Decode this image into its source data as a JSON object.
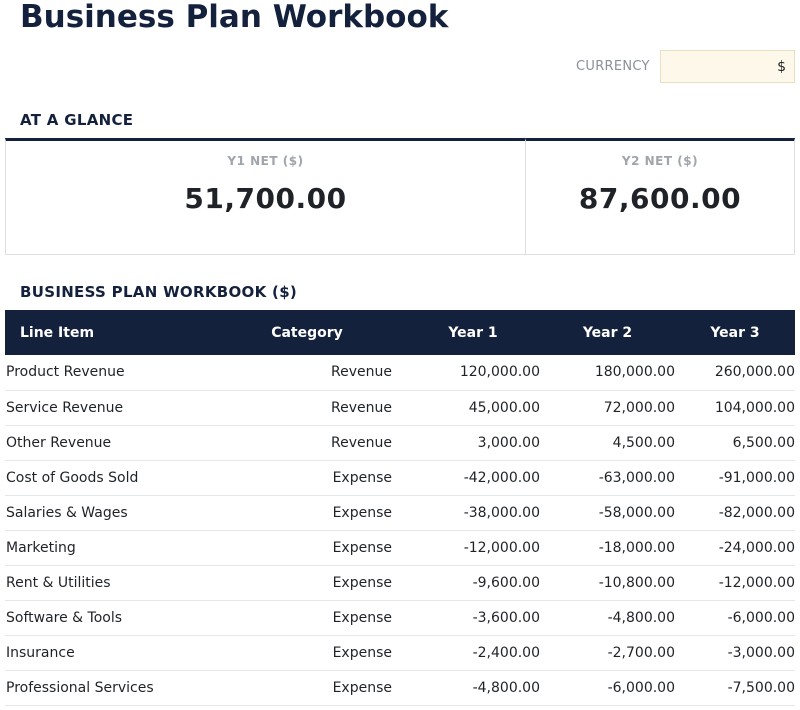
{
  "page": {
    "title": "Business Plan Workbook",
    "currency_label": "CURRENCY",
    "currency_value": "$"
  },
  "glance": {
    "heading": "AT A GLANCE",
    "cards": [
      {
        "label": "Y1 NET ($)",
        "value": "51,700.00"
      },
      {
        "label": "Y2 NET ($)",
        "value": "87,600.00"
      }
    ]
  },
  "table": {
    "heading": "BUSINESS PLAN WORKBOOK ($)",
    "columns": [
      "Line Item",
      "Category",
      "Year 1",
      "Year 2",
      "Year 3"
    ],
    "rows": [
      {
        "item": "Product Revenue",
        "category": "Revenue",
        "y1": "120,000.00",
        "y2": "180,000.00",
        "y3": "260,000.00"
      },
      {
        "item": "Service Revenue",
        "category": "Revenue",
        "y1": "45,000.00",
        "y2": "72,000.00",
        "y3": "104,000.00"
      },
      {
        "item": "Other Revenue",
        "category": "Revenue",
        "y1": "3,000.00",
        "y2": "4,500.00",
        "y3": "6,500.00"
      },
      {
        "item": "Cost of Goods Sold",
        "category": "Expense",
        "y1": "-42,000.00",
        "y2": "-63,000.00",
        "y3": "-91,000.00"
      },
      {
        "item": "Salaries & Wages",
        "category": "Expense",
        "y1": "-38,000.00",
        "y2": "-58,000.00",
        "y3": "-82,000.00"
      },
      {
        "item": "Marketing",
        "category": "Expense",
        "y1": "-12,000.00",
        "y2": "-18,000.00",
        "y3": "-24,000.00"
      },
      {
        "item": "Rent & Utilities",
        "category": "Expense",
        "y1": "-9,600.00",
        "y2": "-10,800.00",
        "y3": "-12,000.00"
      },
      {
        "item": "Software & Tools",
        "category": "Expense",
        "y1": "-3,600.00",
        "y2": "-4,800.00",
        "y3": "-6,000.00"
      },
      {
        "item": "Insurance",
        "category": "Expense",
        "y1": "-2,400.00",
        "y2": "-2,700.00",
        "y3": "-3,000.00"
      },
      {
        "item": "Professional Services",
        "category": "Expense",
        "y1": "-4,800.00",
        "y2": "-6,000.00",
        "y3": "-7,500.00"
      }
    ]
  },
  "colors": {
    "navy": "#14213d",
    "input_bg": "#fdf8ea",
    "muted_label": "#a0a4ab"
  }
}
